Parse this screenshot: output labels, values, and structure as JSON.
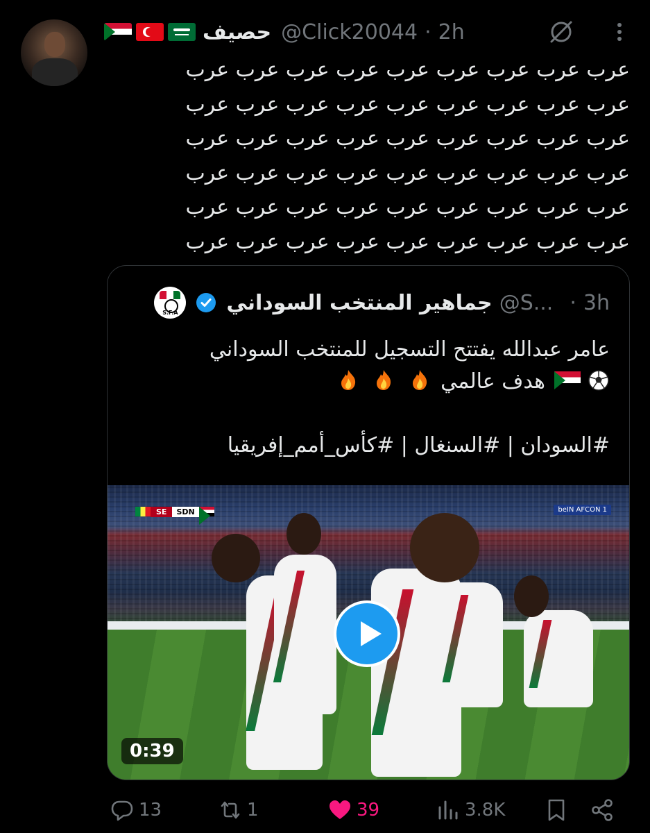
{
  "tweet": {
    "display_name": "حصيف",
    "handle": "@Click20044",
    "separator": "·",
    "time": "2h",
    "flags": [
      "sudan-flag",
      "turkey-flag",
      "saudi-flag"
    ],
    "body_lines": [
      "عرب عرب عرب عرب عرب عرب عرب عرب عرب",
      "عرب عرب عرب عرب عرب عرب عرب عرب عرب",
      "عرب عرب عرب عرب عرب عرب عرب عرب عرب",
      "عرب عرب عرب عرب عرب عرب عرب عرب عرب",
      "عرب عرب عرب عرب عرب عرب عرب عرب عرب",
      "عرب عرب عرب عرب عرب عرب عرب عرب عرب"
    ]
  },
  "quote": {
    "display_name": "جماهير المنتخب السوداني",
    "handle": "@S...",
    "separator": "·",
    "time": "3h",
    "avatar_text": "S.F.A",
    "line1": "عامر عبدالله يفتتح التسجيل للمنتخب السوداني",
    "line2": "هدف عالمي",
    "hashtags": "#السودان | #السنغال | #كأس_أمم_إفريقيا",
    "video": {
      "duration": "0:39",
      "score_home": "SE",
      "score_away": "SDN",
      "broadcaster": "beIN AFCON 1"
    }
  },
  "actions": {
    "replies": "13",
    "reposts": "1",
    "likes": "39",
    "views": "3.8K"
  },
  "colors": {
    "background": "#000000",
    "text": "#e7e9ea",
    "muted": "#71767b",
    "like": "#f91880",
    "accent": "#1d9bf0",
    "border": "#2f3336"
  },
  "icons": [
    "grok-icon",
    "more-icon",
    "verified-badge-icon",
    "reply-icon",
    "repost-icon",
    "like-icon",
    "views-icon",
    "bookmark-icon",
    "share-icon",
    "play-icon",
    "fire-icon",
    "soccer-ball-icon"
  ]
}
